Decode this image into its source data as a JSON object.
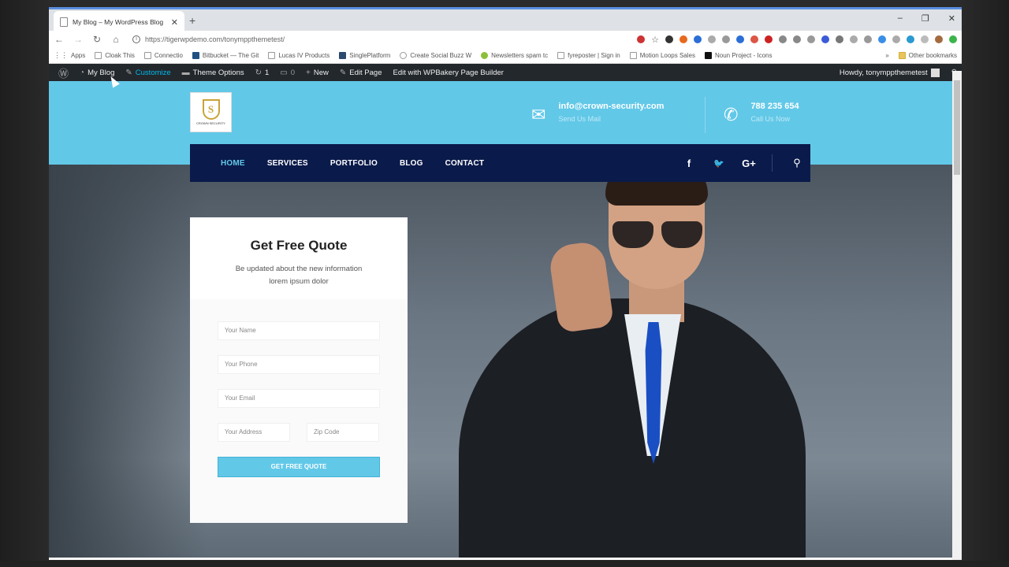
{
  "browser": {
    "tab_title": "My Blog – My WordPress Blog",
    "tab_close": "✕",
    "new_tab": "+",
    "url": "https://tigerwpdemo.com/tonymppthemetest/",
    "window_controls": [
      "–",
      "❐",
      "✕"
    ]
  },
  "bookmarks": {
    "items": [
      "Apps",
      "Cloak This",
      "Connectio",
      "Bitbucket — The Git",
      "Lucas IV Products",
      "SinglePlatform",
      "Create Social Buzz W",
      "Newsletters spam tc",
      "fyreposter | Sign in",
      "Motion Loops Sales",
      "Noun Project - Icons"
    ],
    "more": "»",
    "other": "Other bookmarks"
  },
  "wp_admin": {
    "my_blog": "My Blog",
    "customize": "Customize",
    "theme_options": "Theme Options",
    "updates": "1",
    "comments": "0",
    "new": "New",
    "edit_page": "Edit Page",
    "wpbakery": "Edit with WPBakery Page Builder",
    "howdy": "Howdy, tonymppthemetest"
  },
  "header": {
    "logo_text": "CROWN SECURITY",
    "email": "info@crown-security.com",
    "email_sub": "Send Us Mail",
    "phone": "788 235 654",
    "phone_sub": "Call Us Now"
  },
  "nav": {
    "items": [
      "HOME",
      "SERVICES",
      "PORTFOLIO",
      "BLOG",
      "CONTACT"
    ],
    "social": [
      "f",
      "🐦",
      "G+"
    ]
  },
  "quote": {
    "title": "Get Free Quote",
    "subtitle_1": "Be updated about the new information",
    "subtitle_2": "lorem ipsum dolor",
    "name_placeholder": "Your Name",
    "phone_placeholder": "Your Phone",
    "email_placeholder": "Your Email",
    "address_placeholder": "Your Address",
    "zip_placeholder": "Zip Code",
    "button": "GET FREE QUOTE"
  },
  "colors": {
    "accent": "#62c8e8",
    "nav_bg": "#0a1a4a",
    "wp_bar": "#23282d",
    "tie": "#1a4fc4"
  }
}
